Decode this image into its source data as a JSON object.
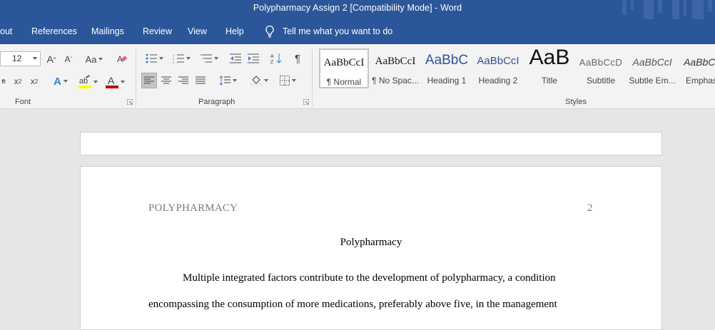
{
  "window": {
    "title": "Polypharmacy Assign 2 [Compatibility Mode]  -  Word"
  },
  "tabs": {
    "items": [
      "out",
      "References",
      "Mailings",
      "Review",
      "View",
      "Help"
    ],
    "tell_me": "Tell me what you want to do"
  },
  "ribbon": {
    "font_size": "12",
    "change_case": "Aa",
    "groups": {
      "font": "Font",
      "paragraph": "Paragraph",
      "styles": "Styles"
    },
    "styles": [
      {
        "sample": "AaBbCcI",
        "name": "¶ Normal"
      },
      {
        "sample": "AaBbCcI",
        "name": "¶ No Spac..."
      },
      {
        "sample": "AaBbC",
        "name": "Heading 1"
      },
      {
        "sample": "AaBbCcI",
        "name": "Heading 2"
      },
      {
        "sample": "AaB",
        "name": "Title"
      },
      {
        "sample": "AaBbCcD",
        "name": "Subtitle"
      },
      {
        "sample": "AaBbCcI",
        "name": "Subtle Em..."
      },
      {
        "sample": "AaBbCc",
        "name": "Emphas"
      }
    ]
  },
  "colors": {
    "titlebar": "#2b579a",
    "ribbon": "#f3f3f3",
    "highlight": "#ffff00",
    "font_color": "#c00000"
  },
  "document": {
    "running_head": "POLYPHARMACY",
    "page_number": "2",
    "title": "Polypharmacy",
    "lines": [
      "Multiple integrated factors contribute to the development of polypharmacy, a condition",
      "encompassing the consumption of more medications, preferably above five, in the management"
    ]
  }
}
